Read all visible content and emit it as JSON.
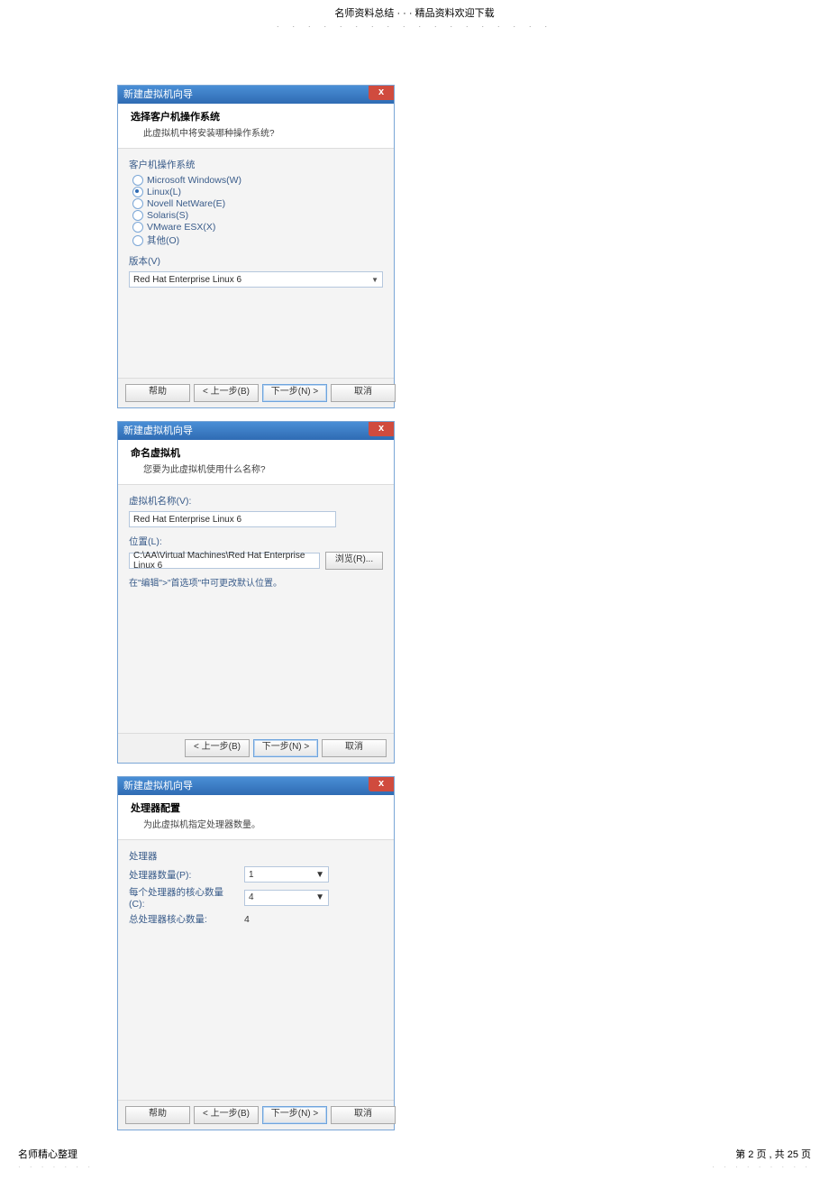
{
  "page_header": {
    "line1": "名师资料总结 · · · 精品资料欢迎下载",
    "dots": "· · · · · · · · · · · · · · · · · ·"
  },
  "dialog1": {
    "title": "新建虚拟机向导",
    "close": "x",
    "header_title": "选择客户机操作系统",
    "header_sub": "此虚拟机中将安装哪种操作系统?",
    "os_group_label": "客户机操作系统",
    "os_options": [
      {
        "label": "Microsoft Windows(W)",
        "checked": false
      },
      {
        "label": "Linux(L)",
        "checked": true
      },
      {
        "label": "Novell NetWare(E)",
        "checked": false
      },
      {
        "label": "Solaris(S)",
        "checked": false
      },
      {
        "label": "VMware ESX(X)",
        "checked": false
      },
      {
        "label": "其他(O)",
        "checked": false
      }
    ],
    "version_label": "版本(V)",
    "version_value": "Red Hat Enterprise Linux 6",
    "buttons": {
      "help": "帮助",
      "back": "< 上一步(B)",
      "next": "下一步(N) >",
      "cancel": "取消"
    }
  },
  "dialog2": {
    "title": "新建虚拟机向导",
    "close": "x",
    "header_title": "命名虚拟机",
    "header_sub": "您要为此虚拟机使用什么名称?",
    "name_label": "虚拟机名称(V):",
    "name_value": "Red Hat Enterprise Linux 6",
    "loc_label": "位置(L):",
    "loc_value": "C:\\AA\\Virtual Machines\\Red Hat Enterprise Linux 6",
    "browse": "浏览(R)...",
    "tip": "在\"编辑\">\"首选项\"中可更改默认位置。",
    "buttons": {
      "back": "< 上一步(B)",
      "next": "下一步(N) >",
      "cancel": "取消"
    }
  },
  "dialog3": {
    "title": "新建虚拟机向导",
    "close": "x",
    "header_title": "处理器配置",
    "header_sub": "为此虚拟机指定处理器数量。",
    "section_label": "处理器",
    "rows": {
      "proc_count_label": "处理器数量(P):",
      "proc_count_value": "1",
      "cores_label": "每个处理器的核心数量(C):",
      "cores_value": "4",
      "total_label": "总处理器核心数量:",
      "total_value": "4"
    },
    "buttons": {
      "help": "帮助",
      "back": "< 上一步(B)",
      "next": "下一步(N) >",
      "cancel": "取消"
    }
  },
  "page_footer": {
    "left": "名师精心整理",
    "right": "第 2 页 , 共 25 页",
    "dots_left": "· · · · · · ·",
    "dots_right": "· · · · · · · · ·"
  }
}
